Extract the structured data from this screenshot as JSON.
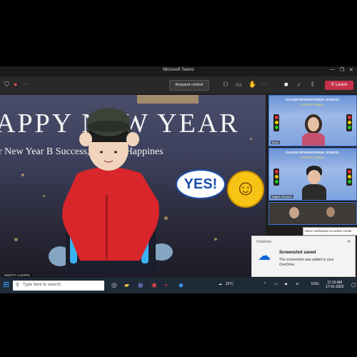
{
  "window": {
    "title": "Microsoft Teams",
    "controls": [
      "—",
      "❐",
      "✕"
    ]
  },
  "toolbar": {
    "left_icons": [
      "shield-icon",
      "record-icon",
      "more-icon"
    ],
    "request_control_label": "Request control",
    "right_icons": [
      "people-icon",
      "chat-icon",
      "raise-hand-icon",
      "more-icon",
      "camera-icon",
      "mic-icon",
      "share-icon",
      "more-icon"
    ],
    "leave_label": "Leave"
  },
  "stage": {
    "banner_line1": "APPY NEW YEAR",
    "banner_line2": "r New Year B       Success, Love & Happines",
    "bubble_text": "YES!",
    "presenter_caption": "DEEPTI CHOPRA"
  },
  "side_tiles": [
    {
      "school": "KALIOR INTERNATIONAL SCHOOL",
      "event": "TRAFFIC SIGNAL",
      "name": "Kiran"
    },
    {
      "school": "KALIOR INTERNATIONAL SCHOOL",
      "event": "TRAFFIC SIGNAL",
      "name": "Rajesh Sharma"
    },
    {
      "name": ""
    }
  ],
  "tooltip": "Move notification to action center",
  "toast": {
    "app": "OneDrive",
    "heading": "Screenshot saved",
    "body": "The screenshot was added to your OneDrive."
  },
  "taskbar": {
    "search_placeholder": "Type here to search",
    "weather": "16°C",
    "language": "ENG",
    "time": "11:16 AM",
    "date": "17-01-2022"
  },
  "colors": {
    "leave": "#c4314b",
    "accent": "#3a6fd0",
    "taskbar": "#1f2a38"
  }
}
